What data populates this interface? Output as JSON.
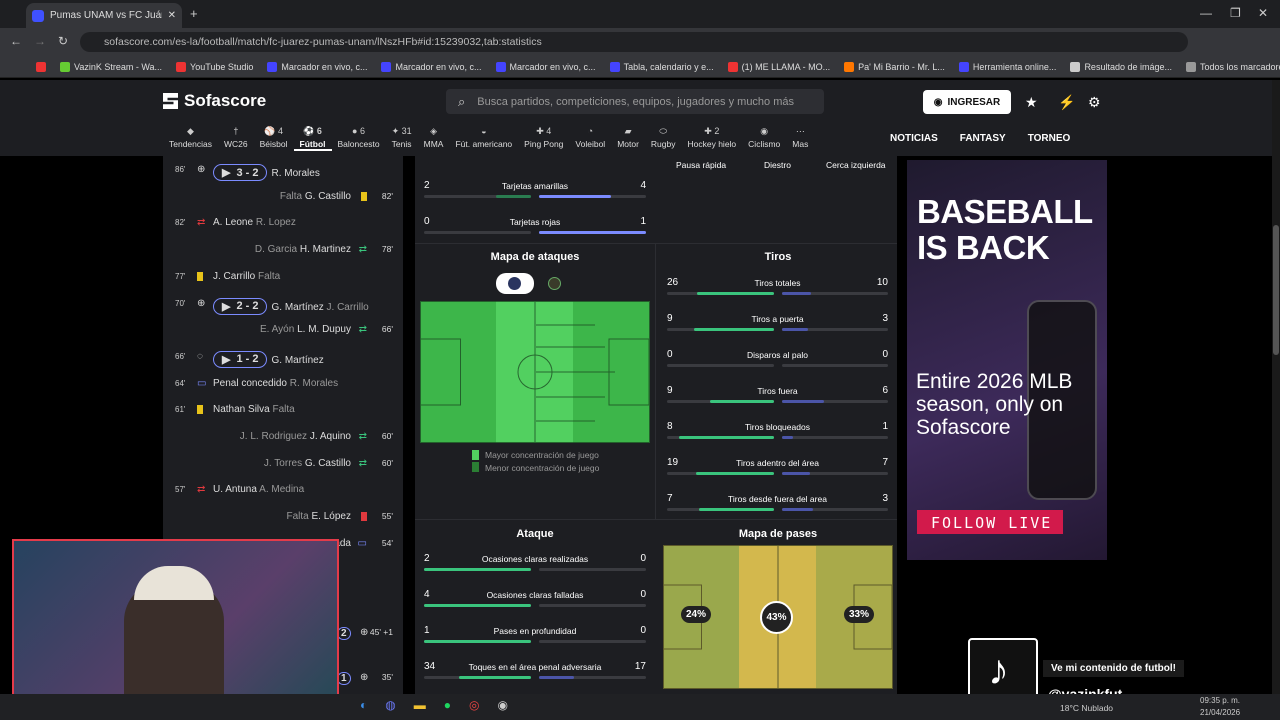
{
  "browser": {
    "tab_title": "Pumas UNAM vs FC Juárez resu",
    "url": "sofascore.com/es-la/football/match/fc-juarez-pumas-unam/lNszHFb#id:15239032,tab:statistics"
  },
  "bookmarks": [
    "VazinK Stream - Wa...",
    "YouTube Studio",
    "Marcador en vivo, c...",
    "Marcador en vivo, c...",
    "Marcador en vivo, c...",
    "Tabla, calendario y e...",
    "(1) ME LLAMA - MO...",
    "Pa' Mi Barrio - Mr. L...",
    "Herramienta online...",
    "Resultado de imáge..."
  ],
  "bookmarks_all": "Todos los marcadores",
  "site": {
    "logo": "Sofascore",
    "search_placeholder": "Busca partidos, competiciones, equipos, jugadores y mucho más",
    "login": "INGRESAR",
    "links": [
      "NOTICIAS",
      "FANTASY",
      "TORNEO"
    ]
  },
  "sports": [
    {
      "label": "Tendencias",
      "c": ""
    },
    {
      "label": "WC26",
      "c": ""
    },
    {
      "label": "Béisbol",
      "c": "4"
    },
    {
      "label": "Fútbol",
      "c": "6"
    },
    {
      "label": "Baloncesto",
      "c": "6"
    },
    {
      "label": "Tenis",
      "c": "31"
    },
    {
      "label": "MMA",
      "c": ""
    },
    {
      "label": "Fút. americano",
      "c": ""
    },
    {
      "label": "Ping Pong",
      "c": "4"
    },
    {
      "label": "Voleibol",
      "c": ""
    },
    {
      "label": "Motor",
      "c": ""
    },
    {
      "label": "Rugby",
      "c": ""
    },
    {
      "label": "Hockey hielo",
      "c": "2"
    },
    {
      "label": "Ciclismo",
      "c": ""
    },
    {
      "label": "Mas",
      "c": ""
    }
  ],
  "events": [
    {
      "min": "86'",
      "score": "3 - 2",
      "name": "R. Morales",
      "kind": "goal",
      "side": "l"
    },
    {
      "min": "82'",
      "name": "G. Castillo",
      "pre": "Falta",
      "kind": "yellow",
      "side": "r"
    },
    {
      "min": "82'",
      "name": "A. Leone",
      "post": "R. Lopez",
      "kind": "sub",
      "side": "l"
    },
    {
      "min": "78'",
      "name": "H. Martinez",
      "pre": "D. Garcia",
      "kind": "sub",
      "side": "r"
    },
    {
      "min": "77'",
      "name": "J. Carrillo",
      "post": "Falta",
      "kind": "yellow",
      "side": "l"
    },
    {
      "min": "70'",
      "score": "2 - 2",
      "name": "G. Martínez",
      "post": "J. Carrillo",
      "kind": "goal",
      "side": "l"
    },
    {
      "min": "66'",
      "name": "L. M. Dupuy",
      "pre": "E. Ayón",
      "kind": "sub",
      "side": "r"
    },
    {
      "min": "66'",
      "score": "1 - 2",
      "name": "G. Martínez",
      "kind": "pen",
      "side": "l"
    },
    {
      "min": "64'",
      "name": "Penal concedido",
      "post": "R. Morales",
      "kind": "var",
      "side": "l"
    },
    {
      "min": "61'",
      "name": "Nathan Silva",
      "post": "Falta",
      "kind": "yellow",
      "side": "l"
    },
    {
      "min": "60'",
      "name": "J. Aquino",
      "pre": "J. L. Rodriguez",
      "kind": "sub",
      "side": "r"
    },
    {
      "min": "60'",
      "name": "G. Castillo",
      "pre": "J. Torres",
      "kind": "sub",
      "side": "r"
    },
    {
      "min": "57'",
      "name": "U. Antuna",
      "post": "A. Medina",
      "kind": "sub",
      "side": "l"
    },
    {
      "min": "55'",
      "name": "E. López",
      "pre": "Falta",
      "kind": "red",
      "side": "r"
    },
    {
      "min": "54'",
      "name": "ada",
      "kind": "var",
      "side": "r"
    }
  ],
  "partial_events": [
    {
      "score": "2",
      "min": "45' +1"
    },
    {
      "score": "1",
      "min": "35'"
    }
  ],
  "top_stats": [
    {
      "l": "Pausa rápida",
      "c": "Diestro",
      "r": "Cerca izquierda"
    }
  ],
  "cards": [
    {
      "name": "Tarjetas amarillas",
      "l": "2",
      "r": "4",
      "lf": 0.33,
      "rf": 0.67
    },
    {
      "name": "Tarjetas rojas",
      "l": "0",
      "r": "1",
      "lf": 0,
      "rf": 1
    }
  ],
  "attack_map": {
    "title": "Mapa de ataques",
    "legend_high": "Mayor concentración de juego",
    "legend_low": "Menor concentración de juego"
  },
  "shots": {
    "title": "Tiros",
    "rows": [
      {
        "name": "Tiros totales",
        "l": "26",
        "r": "10",
        "lf": 0.72,
        "rf": 0.28
      },
      {
        "name": "Tiros a puerta",
        "l": "9",
        "r": "3",
        "lf": 0.75,
        "rf": 0.25
      },
      {
        "name": "Disparos al palo",
        "l": "0",
        "r": "0",
        "lf": 0,
        "rf": 0
      },
      {
        "name": "Tiros fuera",
        "l": "9",
        "r": "6",
        "lf": 0.6,
        "rf": 0.4
      },
      {
        "name": "Tiros bloqueados",
        "l": "8",
        "r": "1",
        "lf": 0.89,
        "rf": 0.11
      },
      {
        "name": "Tiros adentro del área",
        "l": "19",
        "r": "7",
        "lf": 0.73,
        "rf": 0.27
      },
      {
        "name": "Tiros desde fuera del area",
        "l": "7",
        "r": "3",
        "lf": 0.7,
        "rf": 0.3
      }
    ]
  },
  "attack": {
    "title": "Ataque",
    "rows": [
      {
        "name": "Ocasiones claras realizadas",
        "l": "2",
        "r": "0",
        "lf": 1,
        "rf": 0
      },
      {
        "name": "Ocasiones claras falladas",
        "l": "4",
        "r": "0",
        "lf": 1,
        "rf": 0
      },
      {
        "name": "Pases en profundidad",
        "l": "1",
        "r": "0",
        "lf": 1,
        "rf": 0
      },
      {
        "name": "Toques en el área penal adversaria",
        "l": "34",
        "r": "17",
        "lf": 0.67,
        "rf": 0.33
      }
    ]
  },
  "pass_map": {
    "title": "Mapa de pases",
    "zones": [
      "24%",
      "43%",
      "33%"
    ]
  },
  "ad": {
    "headline": "BASEBALL IS BACK",
    "body": "Entire 2026 MLB season, only on Sofascore",
    "cta": "FOLLOW LIVE"
  },
  "overlay": {
    "caption": "Ve mi contenido de futbol!",
    "handle": "@vazinkfut"
  },
  "taskbar": {
    "weather": "18°C  Nublado",
    "time": "09:35 p. m.",
    "date": "21/04/2026"
  }
}
